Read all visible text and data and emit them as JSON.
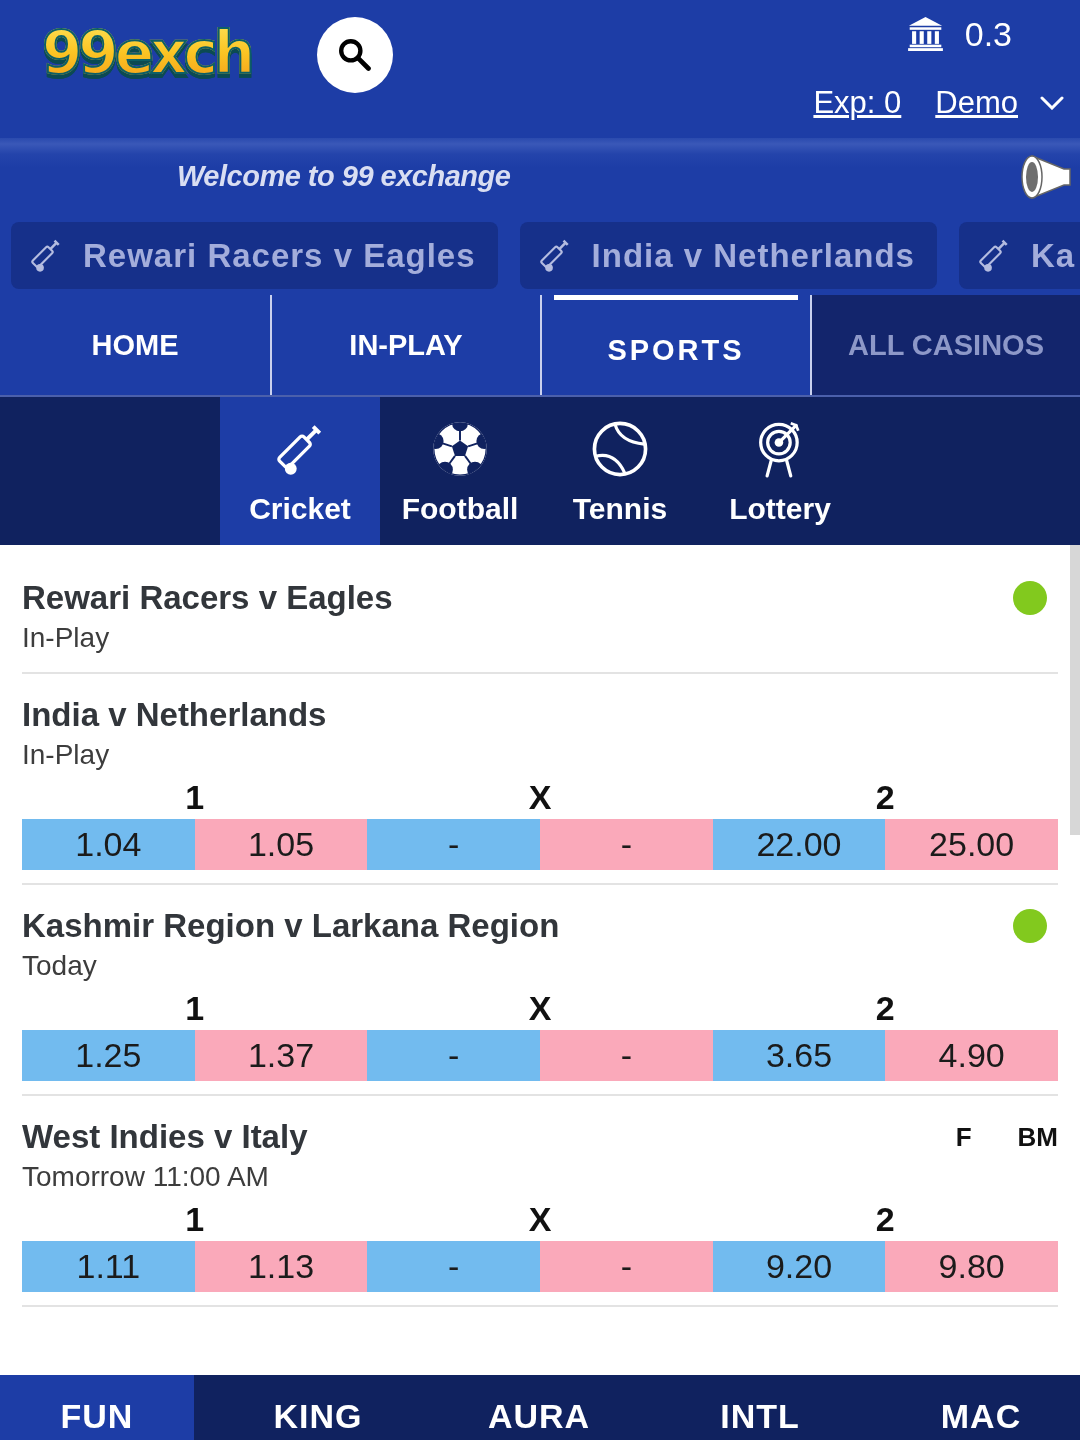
{
  "header": {
    "logo": "99exch",
    "balance": "0.3",
    "exposure": "Exp: 0",
    "account": "Demo"
  },
  "marquee": {
    "text": "Welcome to 99 exchange"
  },
  "event_tabs": [
    {
      "label": "Rewari Racers v Eagles"
    },
    {
      "label": "India v Netherlands"
    },
    {
      "label": "Ka"
    }
  ],
  "nav_tabs": [
    {
      "label": "HOME",
      "selected": false,
      "kind": "page"
    },
    {
      "label": "IN-PLAY",
      "selected": false,
      "kind": "page"
    },
    {
      "label": "SPORTS",
      "selected": true,
      "kind": "page"
    },
    {
      "label": "ALL CASINOS",
      "selected": false,
      "kind": "casino"
    }
  ],
  "sports": [
    {
      "label": "Cricket",
      "selected": true,
      "kind": "cricket"
    },
    {
      "label": "Football",
      "selected": false,
      "kind": "football"
    },
    {
      "label": "Tennis",
      "selected": false,
      "kind": "tennis"
    },
    {
      "label": "Lottery",
      "selected": false,
      "kind": "lottery"
    }
  ],
  "events": [
    {
      "name": "Rewari Racers v Eagles",
      "status": "In-Play",
      "live": true
    },
    {
      "name": "India v Netherlands",
      "status": "In-Play",
      "live": false,
      "markets": [
        {
          "label": "1",
          "back": "1.04",
          "lay": "1.05"
        },
        {
          "label": "X",
          "back": "-",
          "lay": "-"
        },
        {
          "label": "2",
          "back": "22.00",
          "lay": "25.00"
        }
      ]
    },
    {
      "name": "Kashmir Region v Larkana Region",
      "status": "Today",
      "live": true,
      "markets": [
        {
          "label": "1",
          "back": "1.25",
          "lay": "1.37"
        },
        {
          "label": "X",
          "back": "-",
          "lay": "-"
        },
        {
          "label": "2",
          "back": "3.65",
          "lay": "4.90"
        }
      ]
    },
    {
      "name": "West Indies v Italy",
      "status": "Tomorrow 11:00 AM",
      "live": false,
      "badges": [
        "F",
        "BM"
      ],
      "markets": [
        {
          "label": "1",
          "back": "1.11",
          "lay": "1.13"
        },
        {
          "label": "X",
          "back": "-",
          "lay": "-"
        },
        {
          "label": "2",
          "back": "9.20",
          "lay": "9.80"
        }
      ]
    }
  ],
  "bottom_tabs": [
    {
      "label": "FUN",
      "selected": true
    },
    {
      "label": "KING",
      "selected": false
    },
    {
      "label": "AURA",
      "selected": false
    },
    {
      "label": "INTL",
      "selected": false
    },
    {
      "label": "MAC",
      "selected": false
    }
  ]
}
